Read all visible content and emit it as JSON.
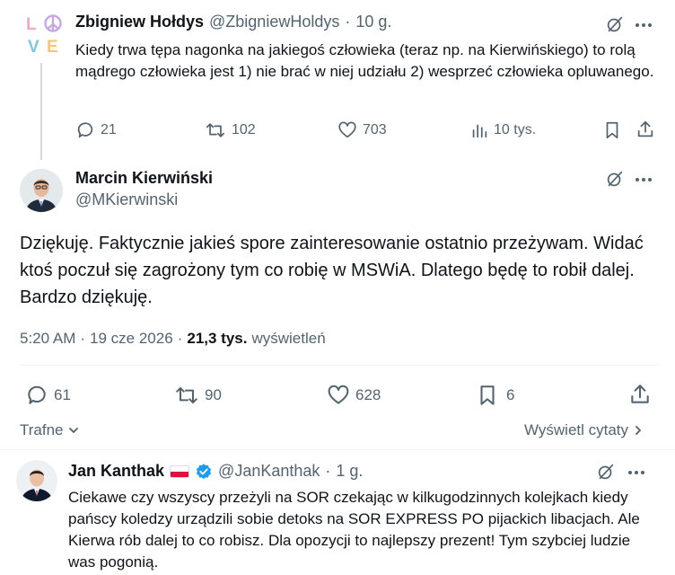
{
  "tweet1": {
    "name": "Zbigniew Hołdys",
    "handle": "@ZbigniewHoldys",
    "dot": "·",
    "time": "10 g.",
    "avatar_letters": [
      "L",
      "V",
      "E"
    ],
    "text": "Kiedy trwa tępa nagonka na jakiegoś człowieka (teraz np. na Kierwińskiego) to rolą mądrego człowieka jest 1) nie brać w niej udziału 2) wesprzeć człowieka opluwanego.",
    "actions": {
      "replies": "21",
      "reposts": "102",
      "likes": "703",
      "views": "10 tys."
    }
  },
  "tweet2": {
    "name": "Marcin Kierwiński",
    "handle": "@MKierwinski",
    "text": "Dziękuję. Faktycznie jakieś spore zainteresowanie ostatnio przeżywam. Widać ktoś poczuł się zagrożony tym co robię w MSWiA. Dlatego będę to robił dalej. Bardzo dziękuję.",
    "meta_time": "5:20 AM",
    "meta_dot1": "·",
    "meta_date": "19 cze 2026",
    "meta_dot2": "·",
    "views_count": "21,3 tys.",
    "views_label": "wyświetleń",
    "actions": {
      "replies": "61",
      "reposts": "90",
      "likes": "628",
      "bookmarks": "6"
    }
  },
  "replies_bar": {
    "sort_label": "Trafne",
    "quotes_label": "Wyświetl cytaty"
  },
  "tweet3": {
    "name": "Jan Kanthak",
    "handle": "@JanKanthak",
    "dot": "·",
    "time": "1 g.",
    "text": "Ciekawe czy wszyscy przeżyli na SOR czekając w kilkugodzinnych kolejkach kiedy pańscy koledzy urządzili sobie detoks na SOR EXPRESS PO pijackich libacjach. Ale Kierwa rób dalej to co robisz. Dla opozycji to najlepszy prezent! Tym szybciej ludzie was pogonią."
  },
  "colors": {
    "text": "#0f1419",
    "muted": "#536471",
    "verified": "#1d9bf0",
    "divider": "#eff3f4"
  }
}
